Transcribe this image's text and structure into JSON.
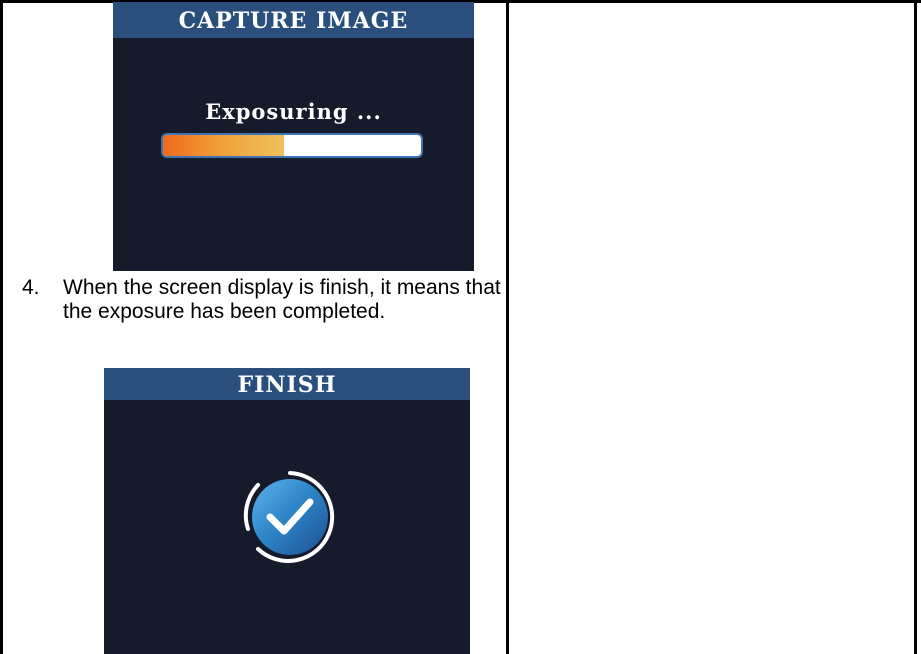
{
  "capture_screen": {
    "title": "CAPTURE IMAGE",
    "status_text": "Exposuring ...",
    "progress_fraction": 0.47,
    "colors": {
      "background": "#161b2b",
      "header": "#2a4f7d",
      "progress_border": "#3f74b4",
      "progress_start": "#ef6a1e",
      "progress_end": "#eec15a"
    }
  },
  "instruction": {
    "number": "4.",
    "text": "When the screen display is finish, it means that the exposure has been completed."
  },
  "finish_screen": {
    "title": "FINISH",
    "icon": "check-circle-icon",
    "colors": {
      "background": "#161b2b",
      "header": "#2a4f7d",
      "icon_fill": "#2f87c8",
      "icon_ring": "#ffffff"
    }
  }
}
